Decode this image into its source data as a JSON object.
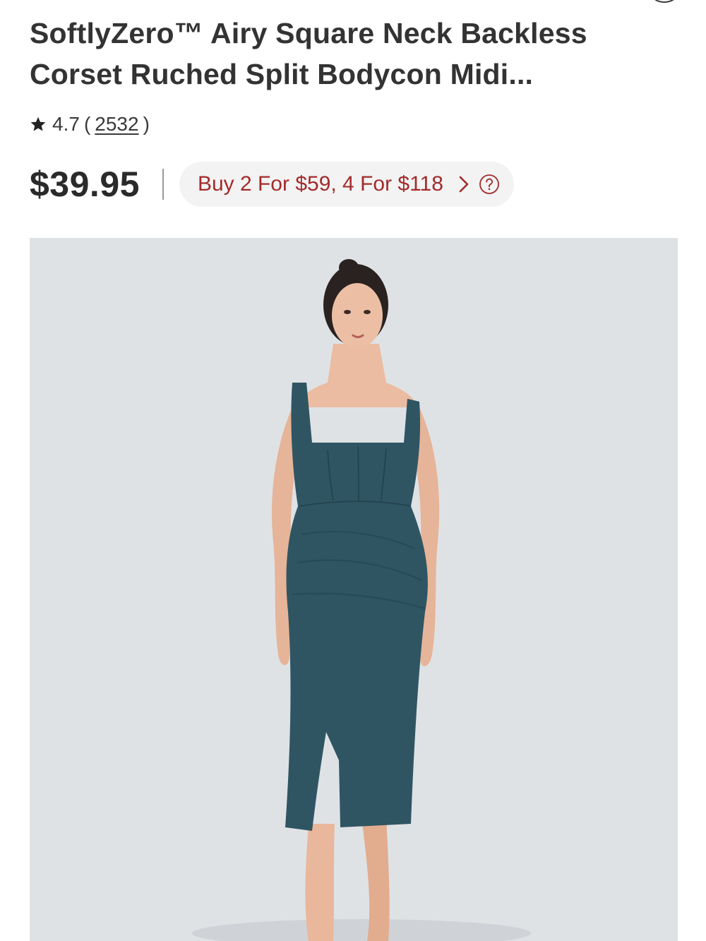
{
  "product": {
    "title": "SoftlyZero™ Airy Square Neck Backless Corset Ruched Split Bodycon Midi...",
    "rating": "4.7",
    "review_count": "2532",
    "price": "$39.95",
    "promo": "Buy 2 For $59, 4 For $118"
  },
  "colors": {
    "promo_text": "#a32b2b",
    "dress": "#2f5563",
    "image_bg": "#dfe2e5"
  },
  "icons": {
    "rating_star": "star-icon",
    "promo_arrow": "chevron-right-icon",
    "promo_help": "question-circle-icon"
  }
}
